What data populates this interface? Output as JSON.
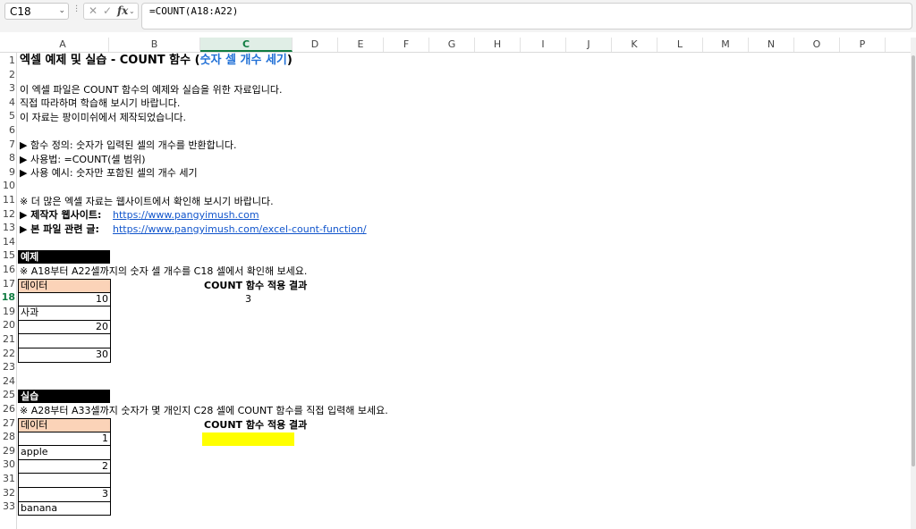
{
  "formula_bar": {
    "name_box": "C18",
    "fx_label": "fx",
    "formula": "=COUNT(A18:A22)"
  },
  "columns": [
    "A",
    "B",
    "C",
    "D",
    "E",
    "F",
    "G",
    "H",
    "I",
    "J",
    "K",
    "L",
    "M",
    "N",
    "O",
    "P"
  ],
  "selected_column": "C",
  "rows": [
    "1",
    "2",
    "3",
    "4",
    "5",
    "6",
    "7",
    "8",
    "9",
    "10",
    "11",
    "12",
    "13",
    "14",
    "15",
    "16",
    "17",
    "18",
    "19",
    "20",
    "21",
    "22",
    "23",
    "24",
    "25",
    "26",
    "27",
    "28",
    "29",
    "30",
    "31",
    "32",
    "33"
  ],
  "selected_row": "18",
  "title": {
    "main": "엑셀 예제 및 실습 - COUNT 함수 (",
    "highlight": "숫자 셀 개수 세기",
    "end": ")"
  },
  "intro": [
    "이 엑셀 파일은 COUNT 함수의 예제와 실습을 위한 자료입니다.",
    "직접 따라하며 학습해 보시기 바랍니다.",
    "이 자료는 팡이미쉬에서 제작되었습니다."
  ],
  "bullets": [
    "▶ 함수 정의: 숫자가 입력된 셀의 개수를 반환합니다.",
    "▶ 사용법: =COUNT(셀 범위)",
    "▶ 사용 예시: 숫자만 포함된 셀의 개수 세기"
  ],
  "more_info": "※ 더 많은 엑셀 자료는 웹사이트에서 확인해 보시기 바랍니다.",
  "site": {
    "label": "▶ 제작자 웹사이트:",
    "url": "https://www.pangyimush.com"
  },
  "related": {
    "label": "▶ 본 파일 관련 글:",
    "url": "https://www.pangyimush.com/excel-count-function/"
  },
  "example": {
    "header": "예제",
    "note": "※ A18부터 A22셀까지의 숫자 셀 개수를 C18 셀에서 확인해 보세요.",
    "data_header": "데이터",
    "data": [
      "10",
      "사과",
      "20",
      "",
      "30"
    ],
    "result_label": "COUNT 함수 적용 결과",
    "result_value": "3"
  },
  "practice": {
    "header": "실습",
    "note": "※ A28부터 A33셀까지 숫자가 몇 개인지 C28 셀에 COUNT 함수를 직접 입력해 보세요.",
    "data_header": "데이터",
    "data": [
      "1",
      "apple",
      "2",
      "",
      "3",
      "banana"
    ],
    "result_label": "COUNT 함수 적용 결과",
    "result_value": ""
  },
  "colors": {
    "data_header_fill": "#fbd3b8",
    "result_fill": "#ffff00",
    "section_header_fill": "#000000",
    "title_highlight": "#1f6fd6",
    "link": "#1155cc"
  }
}
